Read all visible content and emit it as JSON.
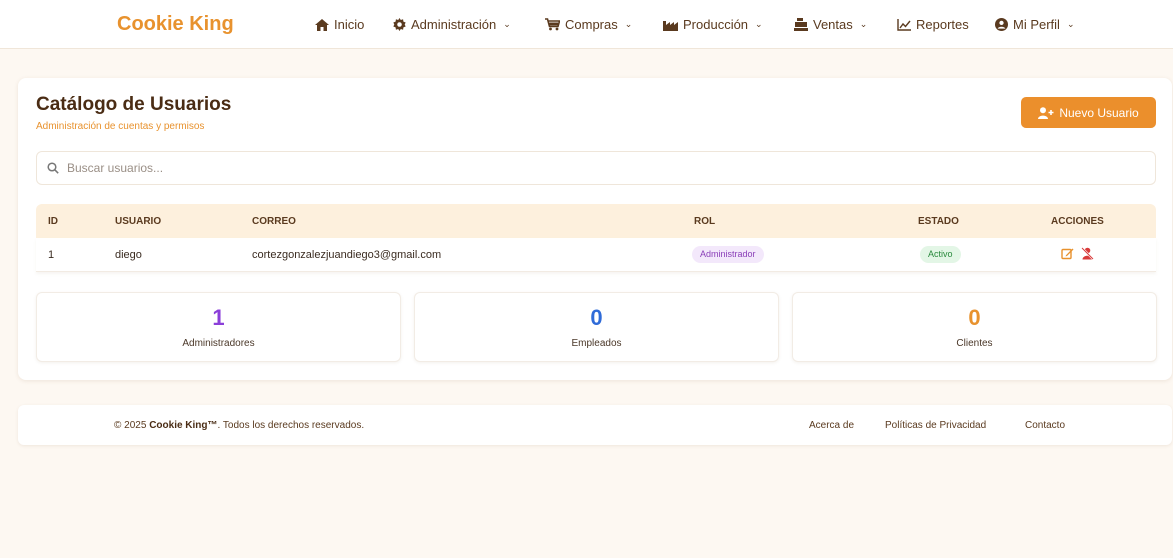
{
  "nav": {
    "brand": "Cookie King",
    "items": [
      {
        "label": "Inicio",
        "icon": "home-icon",
        "dropdown": false
      },
      {
        "label": "Administración",
        "icon": "gear-icon",
        "dropdown": true
      },
      {
        "label": "Compras",
        "icon": "cart-icon",
        "dropdown": true
      },
      {
        "label": "Producción",
        "icon": "factory-icon",
        "dropdown": true
      },
      {
        "label": "Ventas",
        "icon": "cash-register-icon",
        "dropdown": true
      },
      {
        "label": "Reportes",
        "icon": "chart-line-icon",
        "dropdown": false
      },
      {
        "label": "Mi Perfil",
        "icon": "user-circle-icon",
        "dropdown": true
      }
    ]
  },
  "page": {
    "title": "Catálogo de Usuarios",
    "subtitle": "Administración de cuentas y permisos",
    "new_button": "Nuevo Usuario",
    "search_placeholder": "Buscar usuarios..."
  },
  "table": {
    "headers": [
      "ID",
      "USUARIO",
      "CORREO",
      "ROL",
      "ESTADO",
      "ACCIONES"
    ],
    "rows": [
      {
        "id": "1",
        "usuario": "diego",
        "correo": "cortezgonzalezjuandiego3@gmail.com",
        "rol": "Administrador",
        "estado": "Activo"
      }
    ]
  },
  "stats": [
    {
      "value": "1",
      "label": "Administradores",
      "color": "#8b3fd9"
    },
    {
      "value": "0",
      "label": "Empleados",
      "color": "#2f6bd8"
    },
    {
      "value": "0",
      "label": "Clientes",
      "color": "#e8922e"
    }
  ],
  "footer": {
    "copy_prefix": "© 2025",
    "brand": "Cookie King™",
    "copy_suffix": ". Todos los derechos reservados.",
    "links": [
      "Acerca de",
      "Políticas de Privacidad",
      "Contacto"
    ]
  },
  "colors": {
    "accent": "#e8922e",
    "header_bg": "#fdf0dd",
    "page_bg": "#fdf8f2"
  }
}
